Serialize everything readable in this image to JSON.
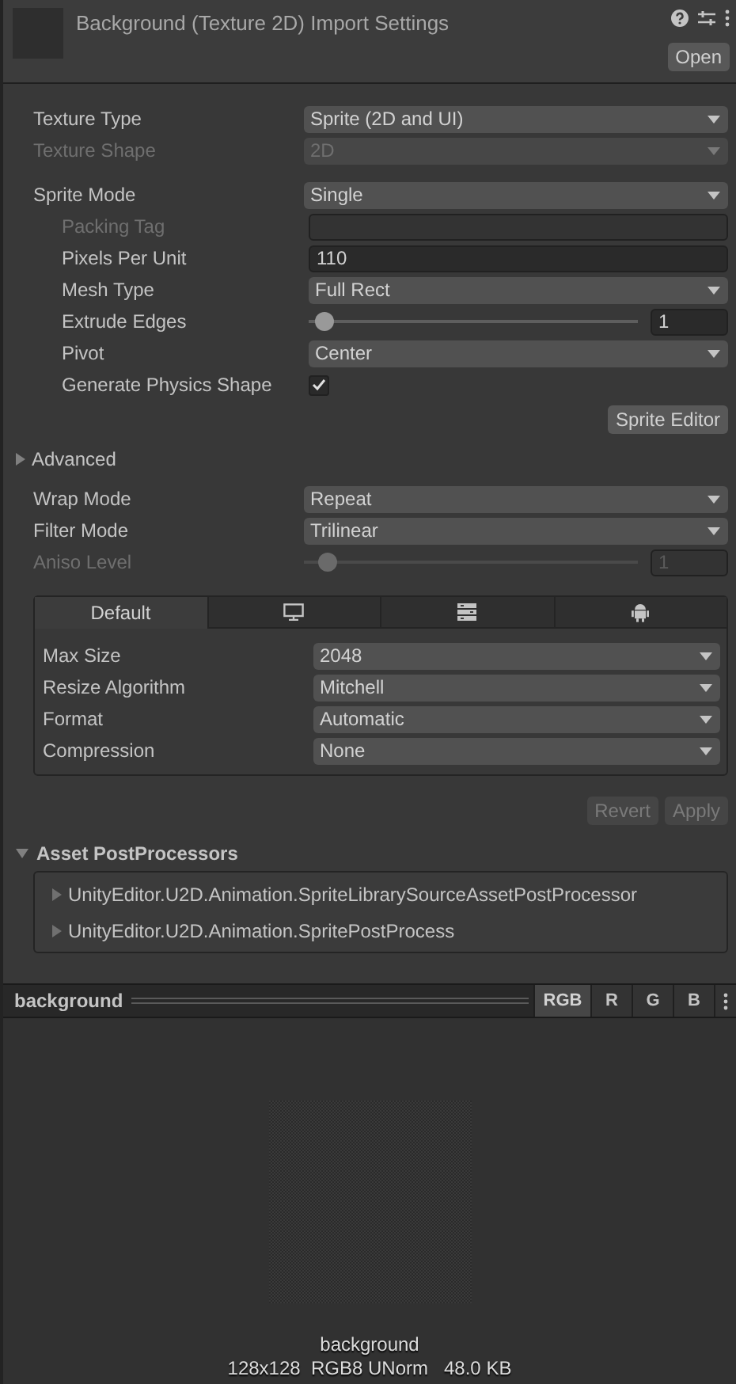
{
  "header": {
    "title": "Background (Texture 2D) Import Settings",
    "open_button": "Open"
  },
  "settings": [
    {
      "kind": "dropdown",
      "label": "Texture Type",
      "value": "Sprite (2D and UI)",
      "disabled": false
    },
    {
      "kind": "dropdown",
      "label": "Texture Shape",
      "value": "2D",
      "disabled": true
    },
    {
      "kind": "gap"
    },
    {
      "kind": "dropdown",
      "label": "Sprite Mode",
      "value": "Single",
      "disabled": false,
      "children": [
        {
          "kind": "text",
          "label": "Packing Tag",
          "disabled": true
        },
        {
          "kind": "text",
          "label": "Pixels Per Unit",
          "value": "110",
          "disabled": false
        },
        {
          "kind": "dropdown",
          "label": "Mesh Type",
          "value": "Full Rect",
          "disabled": false
        },
        {
          "kind": "slider",
          "label": "Extrude Edges",
          "level": 0.03,
          "value": "1",
          "disabled": false
        },
        {
          "kind": "dropdown",
          "label": "Pivot",
          "value": "Center",
          "disabled": false
        },
        {
          "kind": "checkbox",
          "label": "Generate Physics Shape",
          "checked": true,
          "disabled": false
        }
      ]
    }
  ],
  "sprite_editor_button": "Sprite Editor",
  "advanced": {
    "label": "Advanced",
    "expanded": false
  },
  "texture_settings": [
    {
      "kind": "dropdown",
      "label": "Wrap Mode",
      "value": "Repeat",
      "disabled": false
    },
    {
      "kind": "dropdown",
      "label": "Filter Mode",
      "value": "Trilinear",
      "disabled": false
    },
    {
      "kind": "slider",
      "label": "Aniso Level",
      "level": 0.05,
      "value": "1",
      "disabled": true
    }
  ],
  "platform_tabs": [
    {
      "label": "Default",
      "selected": true
    },
    {
      "selected": false
    },
    {
      "selected": false
    },
    {
      "selected": false
    }
  ],
  "platform_settings": [
    {
      "kind": "dropdown",
      "label": "Max Size",
      "value": "2048",
      "disabled": false
    },
    {
      "kind": "dropdown",
      "label": "Resize Algorithm",
      "value": "Mitchell",
      "disabled": false
    },
    {
      "kind": "dropdown",
      "label": "Format",
      "value": "Automatic",
      "disabled": false
    },
    {
      "kind": "dropdown",
      "label": "Compression",
      "value": "None",
      "disabled": false
    }
  ],
  "buttons": [
    {
      "label": "Revert",
      "disabled": true
    },
    {
      "label": "Apply",
      "disabled": true
    }
  ],
  "post_processors": {
    "title": "Asset PostProcessors",
    "expanded": true,
    "items": [
      {
        "label": "UnityEditor.U2D.Animation.SpriteLibrarySourceAssetPostProcessor",
        "expanded": false
      },
      {
        "label": "UnityEditor.U2D.Animation.SpritePostProcess",
        "expanded": false
      }
    ]
  },
  "preview": {
    "title": "background",
    "channels": [
      {
        "label": "RGB",
        "selected": true
      },
      {
        "label": "R",
        "selected": false
      },
      {
        "label": "G",
        "selected": false
      },
      {
        "label": "B",
        "selected": false
      }
    ],
    "name": "background",
    "info": "128x128  RGB8 UNorm   48.0 KB"
  }
}
